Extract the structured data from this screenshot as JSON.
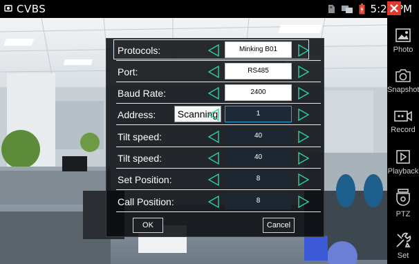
{
  "topbar": {
    "title": "CVBS",
    "time": "5:24 PM",
    "icons": [
      "cvbs-icon",
      "sd-card-icon",
      "network-icon",
      "battery-icon",
      "close-icon"
    ]
  },
  "sidebar": {
    "items": [
      {
        "label": "Photo",
        "icon": "photo-icon"
      },
      {
        "label": "Snapshot",
        "icon": "camera-icon"
      },
      {
        "label": "Record",
        "icon": "record-icon"
      },
      {
        "label": "Playback",
        "icon": "playback-icon"
      },
      {
        "label": "PTZ",
        "icon": "ptz-camera-icon"
      },
      {
        "label": "Set",
        "icon": "tools-icon"
      }
    ]
  },
  "dialog": {
    "rows": [
      {
        "label": "Protocols:",
        "value": "Minking B01"
      },
      {
        "label": "Port:",
        "value": "RS485"
      },
      {
        "label": "Baud Rate:",
        "value": "2400"
      },
      {
        "label": "Address:",
        "value": "1",
        "scan_label": "Scanning"
      },
      {
        "label": "Tilt speed:",
        "value": "40"
      },
      {
        "label": "Tilt speed:",
        "value": "40"
      },
      {
        "label": "Set Position:",
        "value": "8"
      },
      {
        "label": "Call Position:",
        "value": "8"
      }
    ],
    "ok_label": "OK",
    "cancel_label": "Cancel",
    "colors": {
      "arrow": "#2fd0a0",
      "focus": "#2aa7e3",
      "panel": "#1c2731"
    }
  }
}
